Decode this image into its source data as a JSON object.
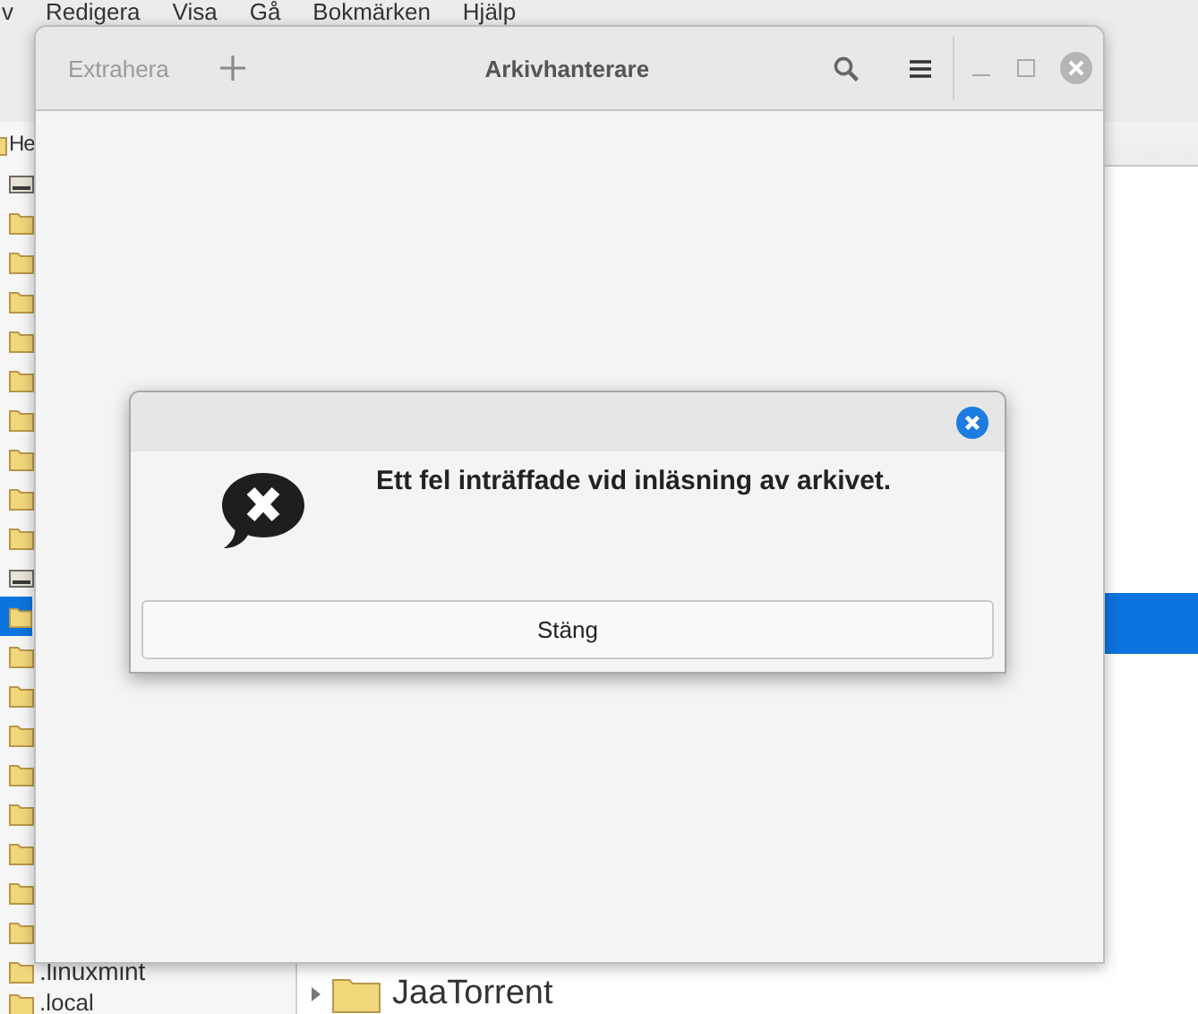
{
  "file_manager": {
    "menu": [
      "v",
      "Redigera",
      "Visa",
      "Gå",
      "Bokmärken",
      "Hjälp"
    ],
    "sidebar": [
      {
        "label": "He",
        "kind": "folder",
        "selected": false
      },
      {
        "kind": "drive",
        "selected": false
      },
      {
        "kind": "folder",
        "selected": false
      },
      {
        "kind": "folder",
        "selected": false
      },
      {
        "kind": "folder",
        "selected": false
      },
      {
        "kind": "folder",
        "selected": false
      },
      {
        "kind": "folder",
        "selected": false
      },
      {
        "kind": "folder",
        "selected": false
      },
      {
        "kind": "folder",
        "selected": false
      },
      {
        "kind": "folder",
        "selected": false
      },
      {
        "kind": "folder",
        "selected": false
      },
      {
        "kind": "drive",
        "selected": false
      },
      {
        "kind": "folder",
        "selected": true
      },
      {
        "kind": "folder",
        "selected": false
      },
      {
        "kind": "folder",
        "selected": false
      },
      {
        "kind": "folder",
        "selected": false
      },
      {
        "kind": "folder",
        "selected": false
      },
      {
        "kind": "folder",
        "selected": false
      },
      {
        "kind": "folder",
        "selected": false
      },
      {
        "kind": "folder",
        "selected": false
      },
      {
        "kind": "folder",
        "selected": false
      },
      {
        "label": ".linuxmint",
        "kind": "folder",
        "selected": false
      },
      {
        "label": ".local",
        "kind": "folder",
        "selected": false
      }
    ],
    "files": [
      {
        "selected": true
      },
      {
        "name": "JaaTorrent",
        "selected": false,
        "expanded": false
      }
    ]
  },
  "archive_window": {
    "title": "Arkivhanterare",
    "extract_button": {
      "label": "Extrahera",
      "disabled": true
    }
  },
  "dialog": {
    "message": "Ett fel inträffade vid inläsning av arkivet.",
    "button": "Stäng"
  }
}
